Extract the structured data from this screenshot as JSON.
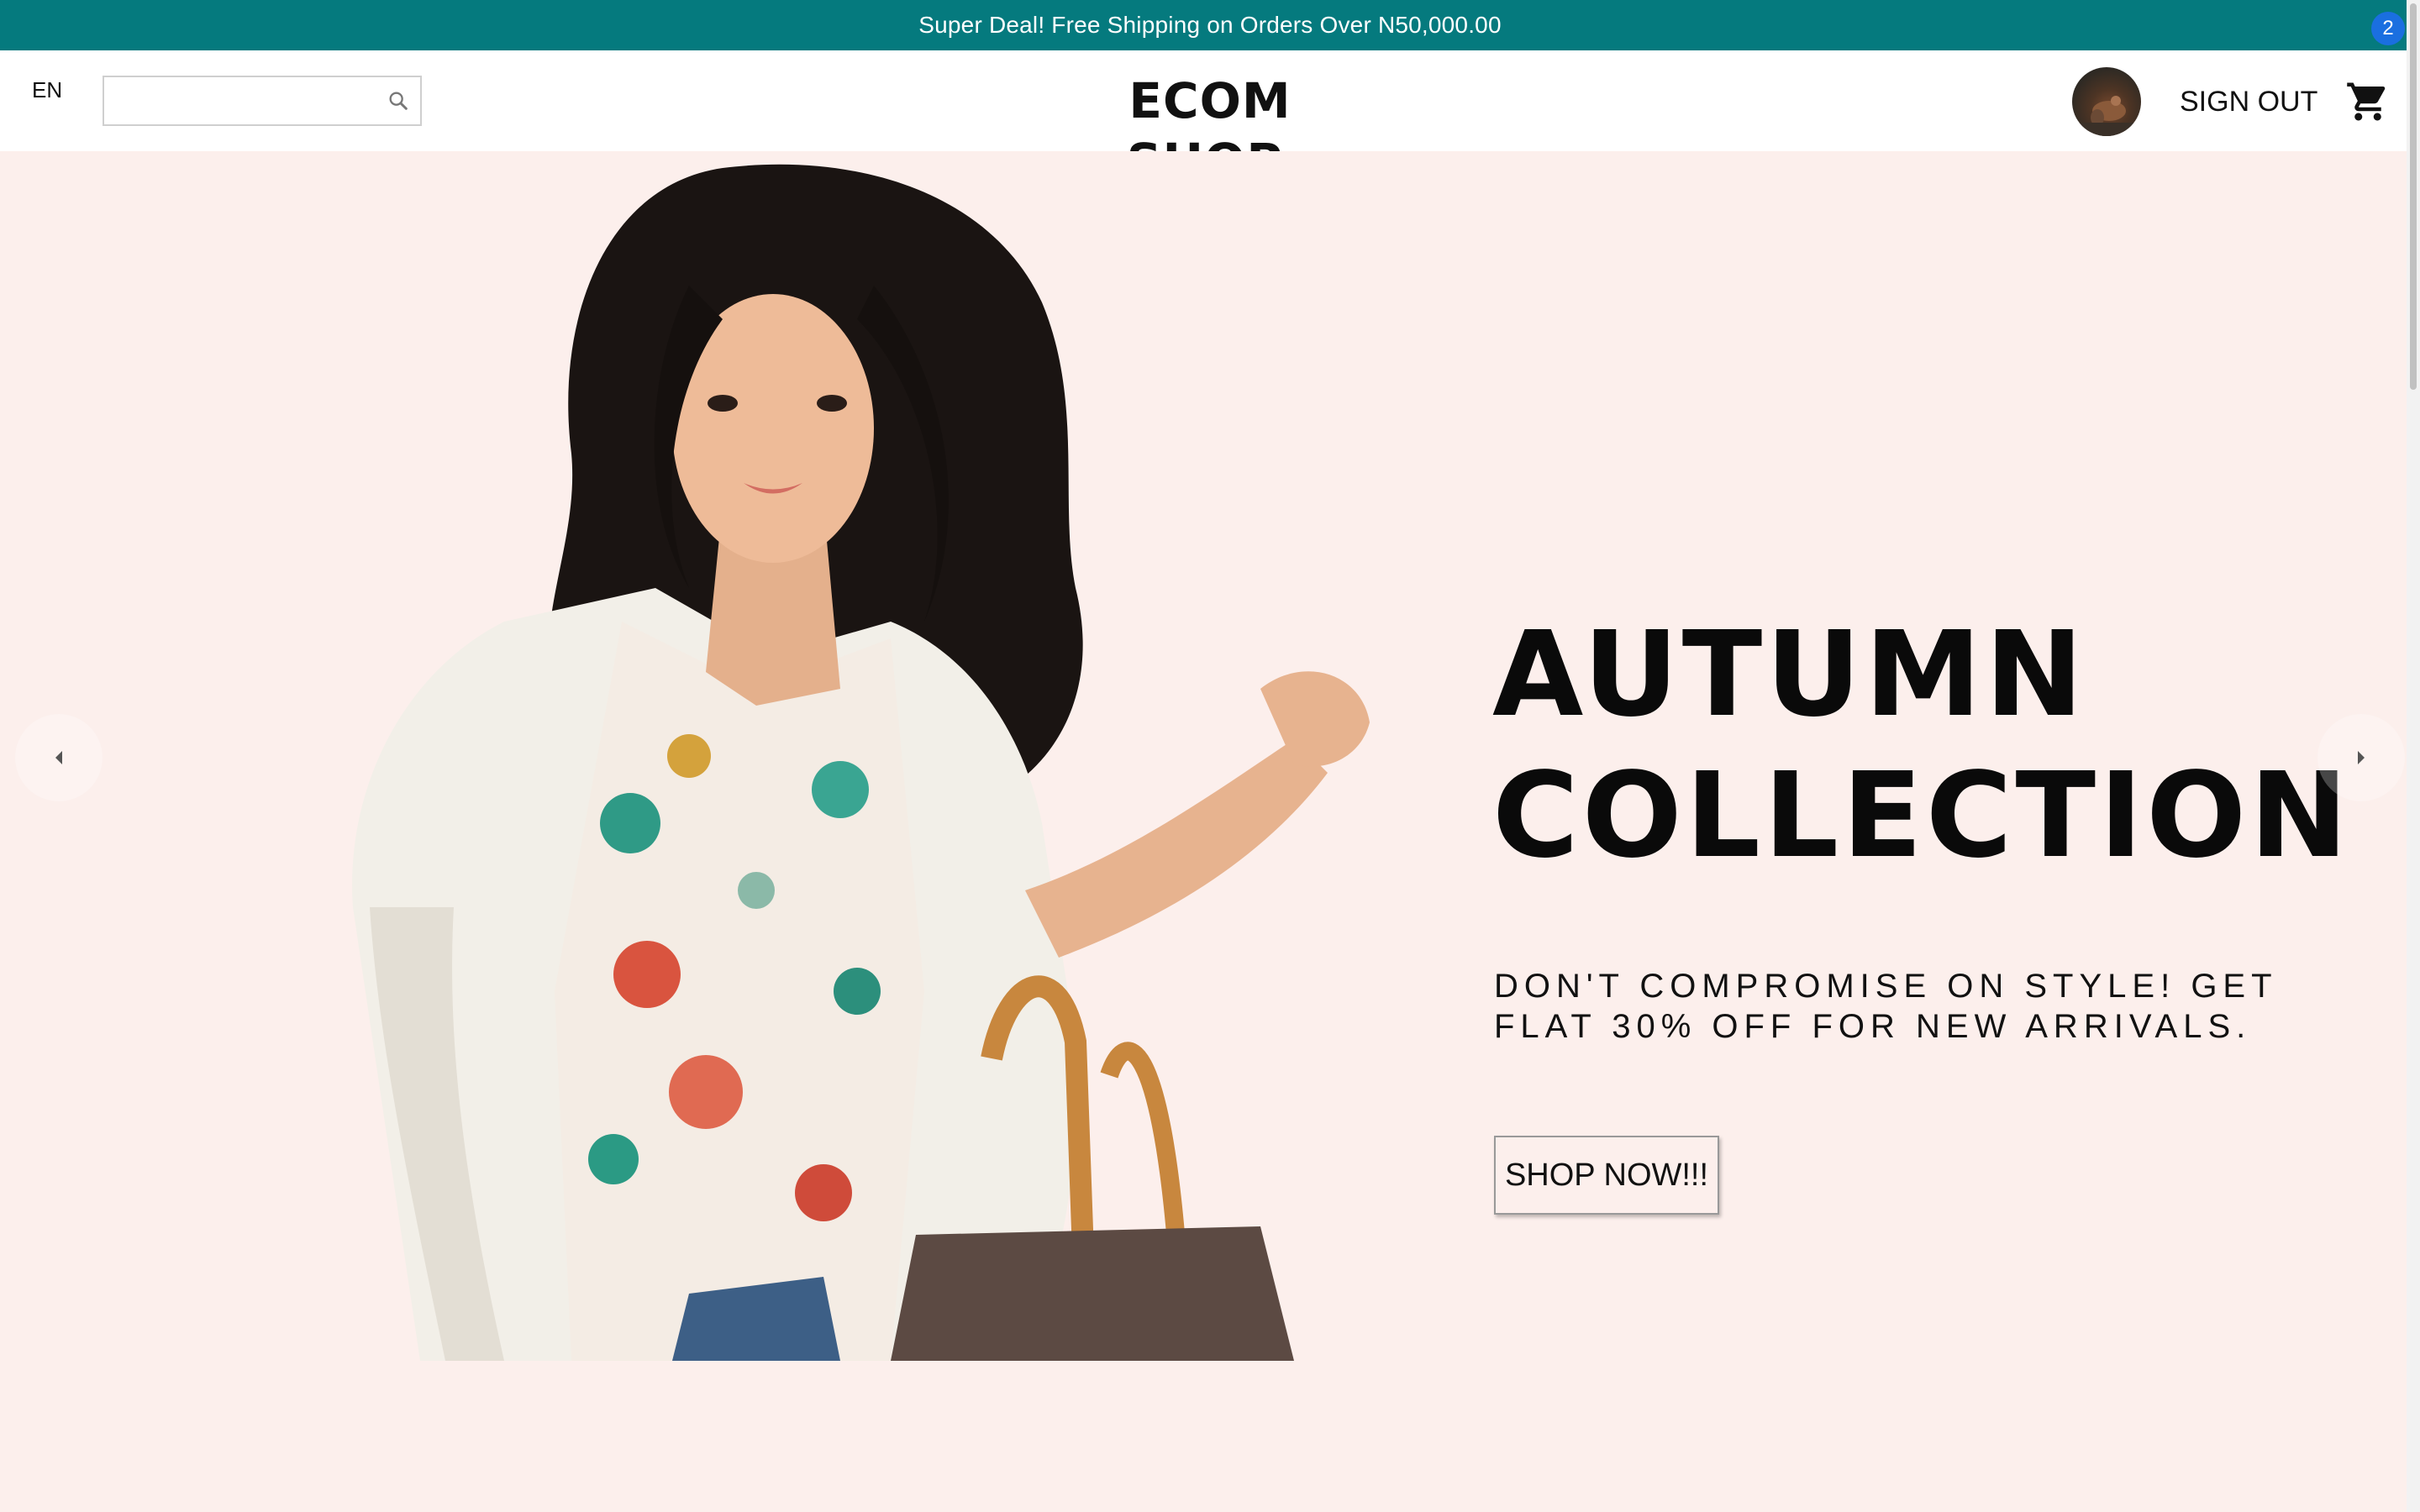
{
  "promo": {
    "text": "Super Deal! Free Shipping on Orders Over N50,000.00"
  },
  "header": {
    "language": "EN",
    "search": {
      "value": "",
      "placeholder": ""
    },
    "logo": "ECOM SHOP.",
    "sign_out_label": "SIGN OUT",
    "cart_count": "2"
  },
  "hero": {
    "title_line1": "AUTUMN",
    "title_line2": "COLLECTION",
    "subtitle": "DON'T COMPROMISE ON STYLE! GET FLAT 30% OFF FOR NEW ARRIVALS.",
    "cta_label": "SHOP NOW!!!"
  },
  "icons": [
    "search-icon",
    "cart-icon",
    "chevron-left-icon",
    "chevron-right-icon"
  ],
  "colors": {
    "promo_bg": "#057a7e",
    "hero_bg": "#fcefec",
    "badge": "#1a6fe0"
  }
}
